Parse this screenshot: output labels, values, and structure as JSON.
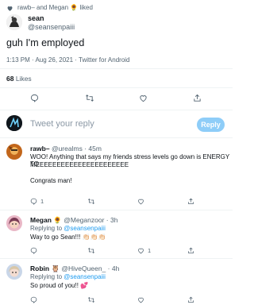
{
  "liked_banner": {
    "text": "rawb– and Megan 🌻 liked",
    "icon": "heart-icon"
  },
  "tweet": {
    "author_name": "sean",
    "author_handle": "@seansenpaiii",
    "text": "guh I'm employed",
    "timestamp": "1:13 PM · Aug 26, 2021 · Twitter for Android",
    "likes_count": "68",
    "likes_label": "Likes"
  },
  "composer": {
    "placeholder": "Tweet your reply",
    "button": "Reply"
  },
  "replies": [
    {
      "name": "rawb–",
      "handle": "@urealms",
      "time": "· 45m",
      "replying_prefix": "",
      "replying_to": "",
      "text_lines": [
        "WOO! Anything that says my friends stress levels go down is ENERGY TO",
        "MEEEEEEEEEEEEEEEEEEEEEE",
        "",
        "Congrats man!"
      ],
      "reply_count": "1",
      "retweet_count": "",
      "like_count": ""
    },
    {
      "name": "Megan 🌻",
      "handle": "@Meganzoor",
      "time": "· 3h",
      "replying_prefix": "Replying to",
      "replying_to": "@seansenpaiii",
      "text_lines": [
        "Way to go Sean!!! 👏🏻👏🏻👏🏻"
      ],
      "reply_count": "",
      "retweet_count": "",
      "like_count": "1"
    },
    {
      "name": "Robin 🦉",
      "handle": "@HiveQueen_",
      "time": "· 4h",
      "replying_prefix": "Replying to",
      "replying_to": "@seansenpaiii",
      "text_lines": [
        "So proud of you!! 💕"
      ],
      "reply_count": "",
      "retweet_count": "",
      "like_count": ""
    }
  ],
  "colors": {
    "accent": "#1d9bf0",
    "muted": "#536471",
    "divider": "#eff3f4"
  }
}
